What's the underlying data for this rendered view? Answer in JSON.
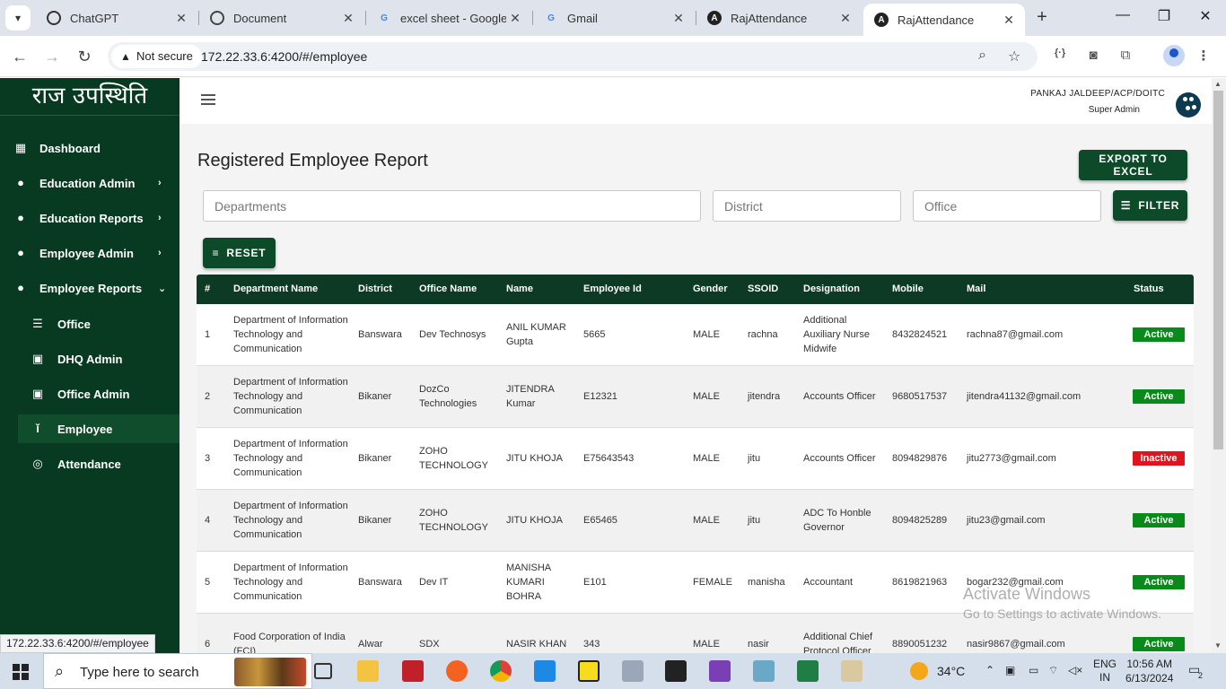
{
  "browser": {
    "tabs": [
      {
        "title": "ChatGPT",
        "color": "#ffffff"
      },
      {
        "title": "Document",
        "color": "#ffffff"
      },
      {
        "title": "excel sheet - Google",
        "color": "#ffffff"
      },
      {
        "title": "Gmail",
        "color": "#ffffff"
      },
      {
        "title": "RajAttendance",
        "color": "#ffffff"
      },
      {
        "title": "RajAttendance",
        "color": "#ffffff"
      }
    ],
    "not_secure": "Not secure",
    "url": "172.22.33.6:4200/#/employee",
    "status_url": "172.22.33.6:4200/#/employee"
  },
  "sidebar": {
    "brand": "राज उपस्थिति",
    "items": [
      {
        "label": "Dashboard",
        "icon": "dashboard-icon"
      },
      {
        "label": "Education Admin",
        "icon": "person-icon"
      },
      {
        "label": "Education Reports",
        "icon": "person-icon"
      },
      {
        "label": "Employee Admin",
        "icon": "person-icon"
      },
      {
        "label": "Employee Reports",
        "icon": "person-icon"
      },
      {
        "label": "Office",
        "icon": "list-icon"
      },
      {
        "label": "DHQ Admin",
        "icon": "calendar-icon"
      },
      {
        "label": "Office Admin",
        "icon": "calendar-icon"
      },
      {
        "label": "Employee",
        "icon": "person-standing-icon"
      },
      {
        "label": "Attendance",
        "icon": "fingerprint-icon"
      }
    ]
  },
  "header": {
    "user_name": "PANKAJ JALDEEP/ACP/DOITC",
    "user_role": "Super Admin"
  },
  "main": {
    "title": "Registered Employee Report",
    "export_label": "EXPORT TO EXCEL",
    "filter_label": "FILTER",
    "reset_label": "RESET",
    "departments_placeholder": "Departments",
    "district_placeholder": "District",
    "office_placeholder": "Office"
  },
  "table": {
    "columns": [
      "#",
      "Department Name",
      "District",
      "Office Name",
      "Name",
      "Employee Id",
      "Gender",
      "SSOID",
      "Designation",
      "Mobile",
      "Mail",
      "Status"
    ],
    "rows": [
      [
        "1",
        "Department of Information Technology and Communication",
        "Banswara",
        "Dev Technosys",
        "ANIL KUMAR Gupta",
        "5665",
        "MALE",
        "rachna",
        "Additional Auxiliary Nurse Midwife",
        "8432824521",
        "rachna87@gmail.com",
        "Active"
      ],
      [
        "2",
        "Department of Information Technology and Communication",
        "Bikaner",
        "DozCo Technologies",
        "JITENDRA Kumar",
        "E12321",
        "MALE",
        "jitendra",
        "Accounts Officer",
        "9680517537",
        "jitendra41132@gmail.com",
        "Active"
      ],
      [
        "3",
        "Department of Information Technology and Communication",
        "Bikaner",
        "ZOHO TECHNOLOGY",
        "JITU KHOJA",
        "E75643543",
        "MALE",
        "jitu",
        "Accounts Officer",
        "8094829876",
        "jitu2773@gmail.com",
        "Inactive"
      ],
      [
        "4",
        "Department of Information Technology and Communication",
        "Bikaner",
        "ZOHO TECHNOLOGY",
        "JITU KHOJA",
        "E65465",
        "MALE",
        "jitu",
        "ADC To Honble Governor",
        "8094825289",
        "jitu23@gmail.com",
        "Active"
      ],
      [
        "5",
        "Department of Information Technology and Communication",
        "Banswara",
        "Dev IT",
        "MANISHA KUMARI BOHRA",
        "E101",
        "FEMALE",
        "manisha",
        "Accountant",
        "8619821963",
        "bogar232@gmail.com",
        "Active"
      ],
      [
        "6",
        "Food Corporation of India (FCI)",
        "Alwar",
        "SDX",
        "NASIR KHAN",
        "343",
        "MALE",
        "nasir",
        "Additional Chief Protocol Officer",
        "8890051232",
        "nasir9867@gmail.com",
        "Active"
      ]
    ]
  },
  "colors": {
    "active": "#0a8a1a",
    "inactive": "#e0141e",
    "sidebar": "#083a22",
    "button": "#0d4a2a"
  },
  "watermark": {
    "line1": "Activate Windows",
    "line2": "Go to Settings to activate Windows."
  },
  "taskbar": {
    "search_placeholder": "Type here to search",
    "weather": "34°C",
    "lang_1": "ENG",
    "lang_2": "IN",
    "time": "10:56 AM",
    "date": "6/13/2024",
    "notification_count": "2"
  }
}
